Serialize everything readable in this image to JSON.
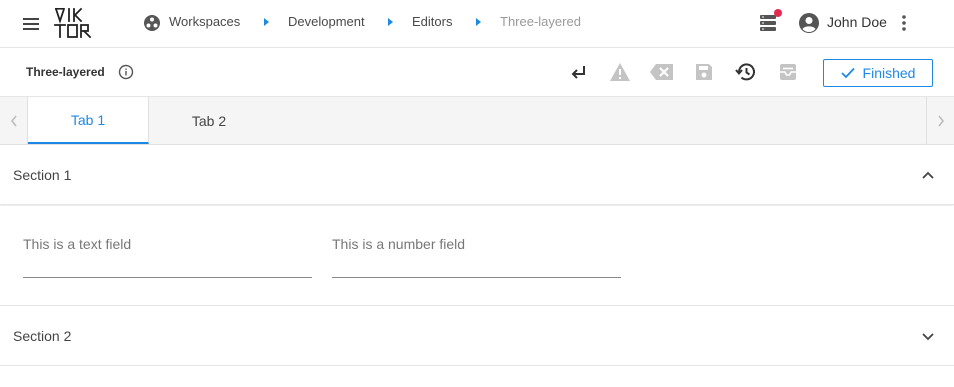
{
  "header": {
    "logo_text": "VIKTOR",
    "breadcrumbs": [
      {
        "label": "Workspaces"
      },
      {
        "label": "Development"
      },
      {
        "label": "Editors"
      },
      {
        "label": "Three-layered"
      }
    ],
    "user_name": "John Doe",
    "notification_color": "#e5294e"
  },
  "toolbar": {
    "entity_title": "Three-layered",
    "tools": [
      "return-icon",
      "warning-icon",
      "backspace-icon",
      "save-icon",
      "history-icon",
      "inbox-icon"
    ],
    "finished_label": "Finished",
    "accent_color": "#1e88e5"
  },
  "tabs": [
    {
      "label": "Tab 1",
      "active": true
    },
    {
      "label": "Tab 2",
      "active": false
    }
  ],
  "sections": [
    {
      "title": "Section 1",
      "expanded": true,
      "fields": [
        {
          "label": "This is a text field",
          "value": ""
        },
        {
          "label": "This is a number field",
          "value": ""
        }
      ]
    },
    {
      "title": "Section 2",
      "expanded": false
    }
  ]
}
